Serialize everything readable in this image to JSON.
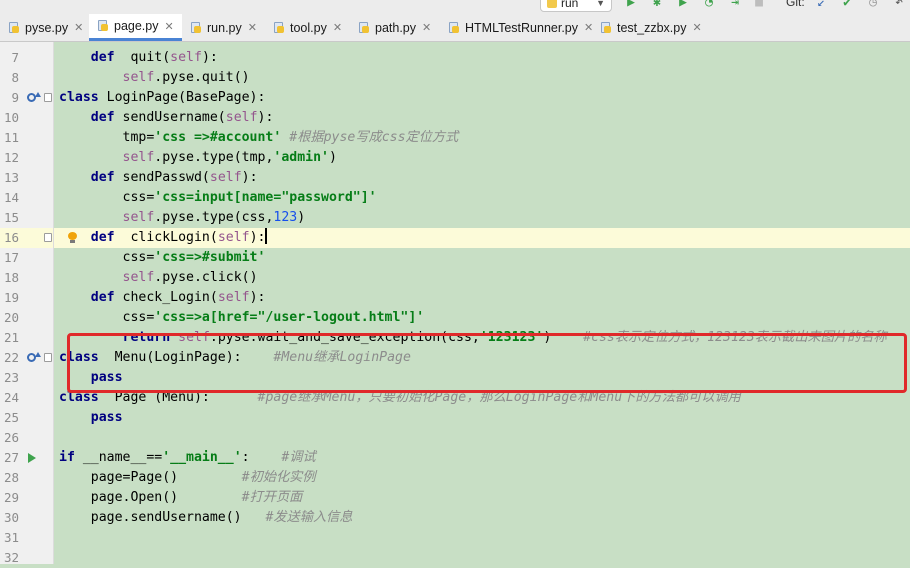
{
  "toolbar": {
    "run_config": "run",
    "git_label": "Git:",
    "icons": [
      "run-icon",
      "debug-icon",
      "coverage-icon",
      "profile-icon",
      "step-icon",
      "stop-icon",
      "vcs-update-icon",
      "vcs-commit-icon",
      "history-icon",
      "revert-icon"
    ]
  },
  "tabs": [
    {
      "label": "pyse.py",
      "active": false
    },
    {
      "label": "page.py",
      "active": true
    },
    {
      "label": "run.py",
      "active": false
    },
    {
      "label": "tool.py",
      "active": false
    },
    {
      "label": "path.py",
      "active": false
    },
    {
      "label": "HTMLTestRunner.py",
      "active": false
    },
    {
      "label": "test_zzbx.py",
      "active": false
    }
  ],
  "colors": {
    "highlight_box": "#e0292a",
    "editor_bg": "#c8dfc5",
    "current_line": "#fcfbd9",
    "active_tab_underline": "#4a83d4"
  },
  "editor": {
    "current_line": 16,
    "lines": [
      {
        "n": "7",
        "code": "    def  quit(self):"
      },
      {
        "n": "8",
        "code": "        self.pyse.quit()"
      },
      {
        "n": "9",
        "code": "class LoginPage(BasePage):"
      },
      {
        "n": "10",
        "code": "    def sendUsername(self):"
      },
      {
        "n": "11",
        "code": "        tmp='css =>#account' #根据pyse写成css定位方式"
      },
      {
        "n": "12",
        "code": "        self.pyse.type(tmp,'admin')"
      },
      {
        "n": "13",
        "code": "    def sendPasswd(self):"
      },
      {
        "n": "14",
        "code": "        css='css=input[name=\"password\"]'"
      },
      {
        "n": "15",
        "code": "        self.pyse.type(css,123)"
      },
      {
        "n": "16",
        "code": "    def  clickLogin(self):"
      },
      {
        "n": "17",
        "code": "        css='css=>#submit'"
      },
      {
        "n": "18",
        "code": "        self.pyse.click()"
      },
      {
        "n": "19",
        "code": "    def check_Login(self):"
      },
      {
        "n": "20",
        "code": "        css='css=>a[href=\"/user-logout.html\"]'"
      },
      {
        "n": "21",
        "code": "        return self.pyse.wait_and_save_exception(css,'123123')    #css表示定位方式，123123表示截出来图片的名称"
      },
      {
        "n": "22",
        "code": "class  Menu(LoginPage):    #Menu继承LoginPage"
      },
      {
        "n": "23",
        "code": "    pass"
      },
      {
        "n": "24",
        "code": "class  Page (Menu):      #page继承Menu，只要初始化Page，那么LoginPage和Menu下的方法都可以调用"
      },
      {
        "n": "25",
        "code": "    pass"
      },
      {
        "n": "26",
        "code": ""
      },
      {
        "n": "27",
        "code": "if __name__=='__main__':    #调试"
      },
      {
        "n": "28",
        "code": "    page=Page()        #初始化实例"
      },
      {
        "n": "29",
        "code": "    page.Open()        #打开页面"
      },
      {
        "n": "30",
        "code": "    page.sendUsername()   #发送输入信息"
      },
      {
        "n": "31",
        "code": ""
      },
      {
        "n": "32",
        "code": ""
      }
    ]
  }
}
